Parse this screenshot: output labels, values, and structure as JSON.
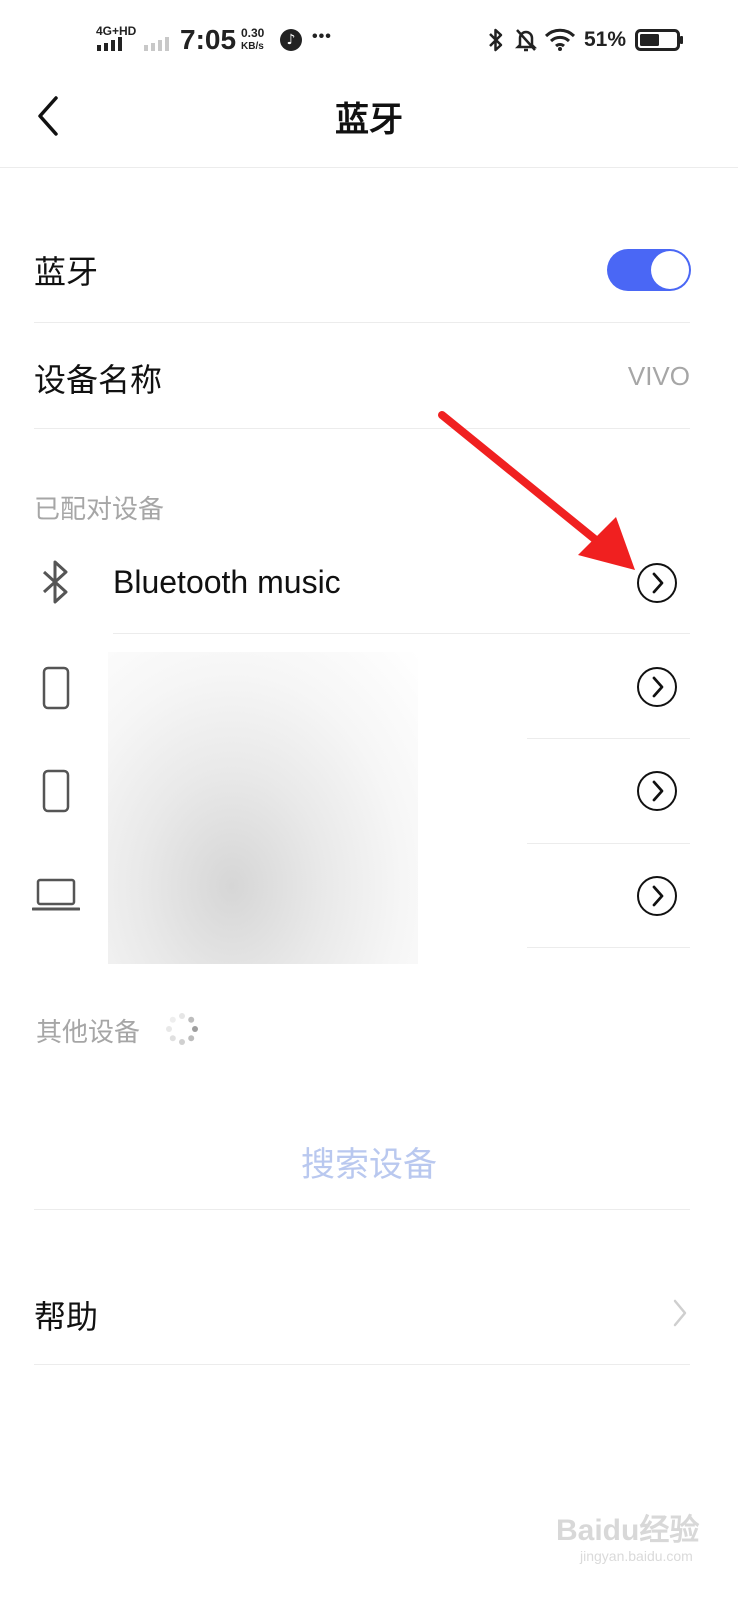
{
  "status_bar": {
    "network": "4G+HD",
    "time": "7:05",
    "speed_value": "0.30",
    "speed_unit": "KB/s",
    "more": "•••",
    "battery": "51%"
  },
  "header": {
    "title": "蓝牙"
  },
  "bluetooth_row": {
    "label": "蓝牙",
    "enabled": true,
    "toggle_color": "#4a67f5"
  },
  "device_name_row": {
    "label": "设备名称",
    "value": "VIVO"
  },
  "paired": {
    "section_label": "已配对设备",
    "devices": [
      {
        "icon": "bluetooth-icon",
        "name": "Bluetooth music"
      },
      {
        "icon": "phone-icon",
        "name": ""
      },
      {
        "icon": "phone-icon",
        "name": ""
      },
      {
        "icon": "laptop-icon",
        "name": ""
      }
    ]
  },
  "other": {
    "section_label": "其他设备"
  },
  "search_button": {
    "label": "搜索设备"
  },
  "help_row": {
    "label": "帮助"
  },
  "watermark": {
    "text": "Baidu经验",
    "sub": "jingyan.baidu.com"
  },
  "accent_colors": {
    "toggle": "#4a67f5",
    "search_text": "#b9c8ef",
    "annotation_arrow": "#f02020"
  }
}
